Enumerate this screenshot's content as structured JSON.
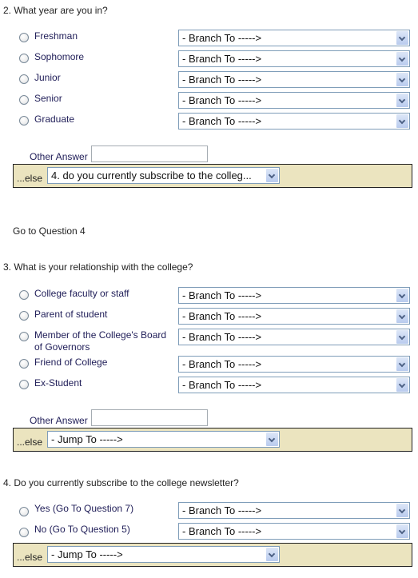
{
  "questions": [
    {
      "title": "2. What year are you in?",
      "options": [
        {
          "label": "Freshman",
          "branch": "- Branch To ----->"
        },
        {
          "label": "Sophomore",
          "branch": "- Branch To ----->"
        },
        {
          "label": "Junior",
          "branch": "- Branch To ----->"
        },
        {
          "label": "Senior",
          "branch": "- Branch To ----->"
        },
        {
          "label": "Graduate",
          "branch": "- Branch To ----->"
        }
      ],
      "other_label": "Other Answer",
      "other_value": "",
      "else_label": "...else",
      "else_select": "4. do you currently subscribe to the colleg...",
      "footer": "Go to Question 4"
    },
    {
      "title": "3. What is your relationship with the college?",
      "options": [
        {
          "label": "College faculty or staff",
          "branch": "- Branch To ----->"
        },
        {
          "label": "Parent of student",
          "branch": "- Branch To ----->"
        },
        {
          "label": "Member of the College's Board of Governors",
          "branch": "- Branch To ----->"
        },
        {
          "label": "Friend of College",
          "branch": "- Branch To ----->"
        },
        {
          "label": "Ex-Student",
          "branch": "- Branch To ----->"
        }
      ],
      "other_label": "Other Answer",
      "other_value": "",
      "else_label": "...else",
      "else_select": "- Jump To ----->"
    },
    {
      "title": "4. Do you currently subscribe to the college newsletter?",
      "options": [
        {
          "label": "Yes (Go To Question 7)",
          "branch": "- Branch To ----->"
        },
        {
          "label": "No (Go To Question 5)",
          "branch": "- Branch To ----->"
        }
      ],
      "else_label": "...else",
      "else_select": "- Jump To ----->"
    }
  ],
  "colors": {
    "else_bar_bg": "#ebe4bf",
    "option_text": "#22205a",
    "select_border": "#7f9db9"
  }
}
